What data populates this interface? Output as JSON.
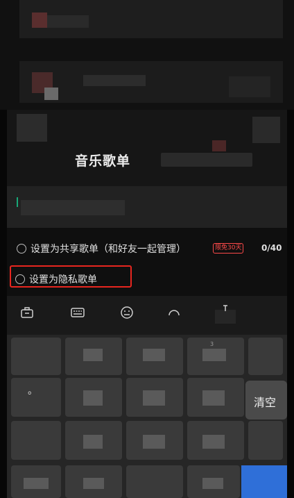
{
  "dialog": {
    "title": "音乐歌单"
  },
  "options": {
    "shared_label": "设置为共享歌单（和好友一起管理）",
    "vip_badge": "限免30天",
    "counter": "0/40",
    "private_label": "设置为隐私歌单"
  },
  "toolbar": {
    "icons": [
      "briefcase-icon",
      "keyboard-icon",
      "emoji-icon",
      "arc-icon",
      "text-cursor-icon"
    ]
  },
  "keyboard": {
    "clear_label": "清空",
    "dot_label": "。",
    "digit_hint": "3"
  },
  "colors": {
    "highlight_border": "#e8261f",
    "accent_blue": "#2f6fd8",
    "cursor_green": "#18a878",
    "badge_red": "#ff4a4a"
  }
}
